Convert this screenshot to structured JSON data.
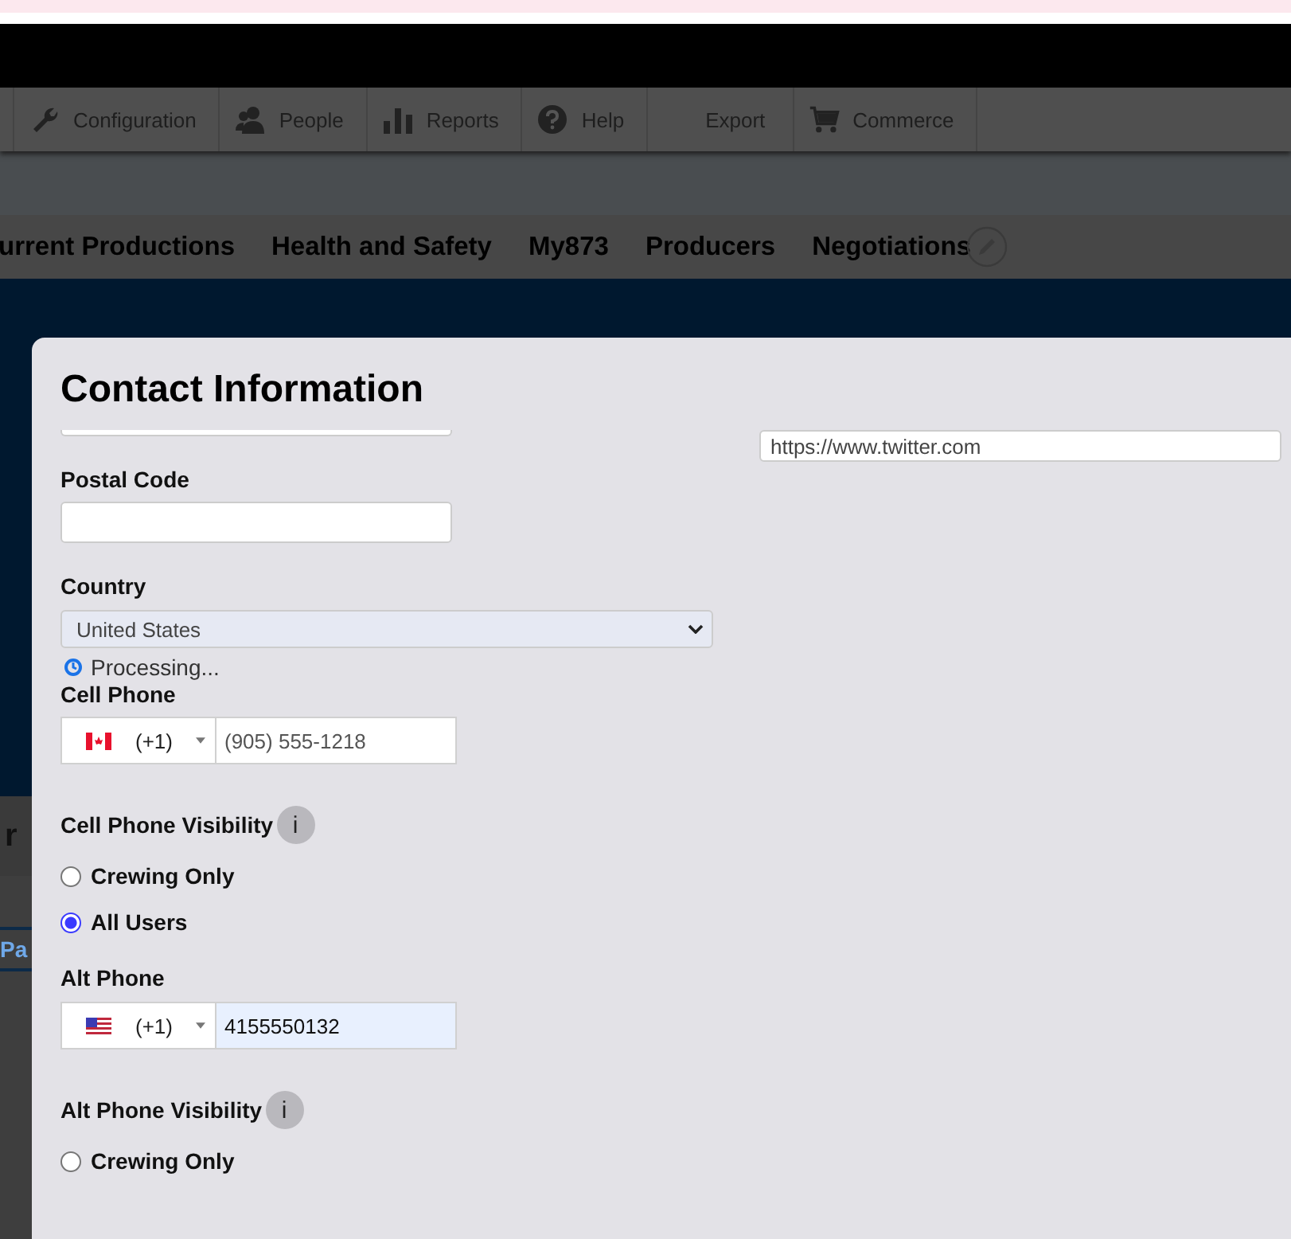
{
  "toolbar": {
    "items": [
      {
        "label": "Configuration"
      },
      {
        "label": "People"
      },
      {
        "label": "Reports"
      },
      {
        "label": "Help"
      },
      {
        "label": "Export"
      },
      {
        "label": "Commerce"
      }
    ]
  },
  "nav": {
    "items": [
      "urrent Productions",
      "Health and Safety",
      "My873",
      "Producers",
      "Negotiations"
    ]
  },
  "background": {
    "heading": "r",
    "tab": "Pa"
  },
  "modal": {
    "title": "Contact Information",
    "postal_code": {
      "label": "Postal Code"
    },
    "country": {
      "label": "Country",
      "value": "United States"
    },
    "processing": "Processing...",
    "cell_phone": {
      "label": "Cell Phone",
      "dial_code": "(+1)",
      "value": "(905) 555-1218",
      "autofilled": false
    },
    "cell_visibility": {
      "label": "Cell Phone Visibility",
      "info": "i",
      "options": [
        {
          "label": "Crewing Only",
          "selected": false
        },
        {
          "label": "All Users",
          "selected": true
        }
      ]
    },
    "alt_phone": {
      "label": "Alt Phone",
      "dial_code": "(+1)",
      "value": "4155550132",
      "autofilled": true
    },
    "alt_visibility": {
      "label": "Alt Phone Visibility",
      "info": "i",
      "options": [
        {
          "label": "Crewing Only",
          "selected": false
        }
      ]
    },
    "twitter": {
      "value": "https://www.twitter.com"
    }
  }
}
